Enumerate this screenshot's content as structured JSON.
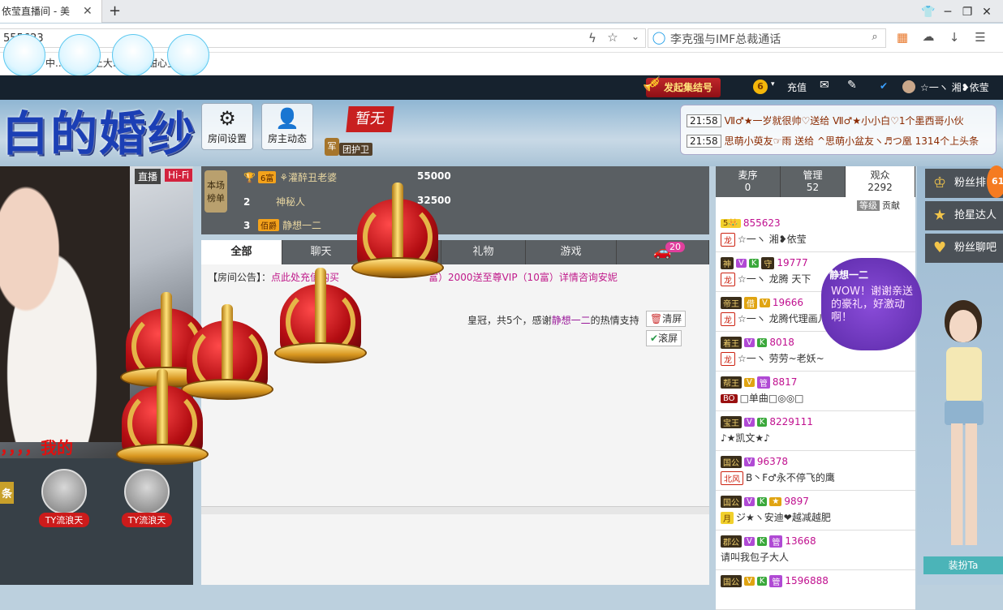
{
  "browser": {
    "tab_title": "依莹直播间 - 美",
    "url": "555623",
    "search_placeholder": "李克强与IMF总裁通话",
    "bookmarks": "中.. 连接.. 上大.. 东视. 甜心宝"
  },
  "sitebar": {
    "gather_label": "发起集结号",
    "coin": "6",
    "recharge": "充值",
    "username": "☆一ヽ 湘❥依莹"
  },
  "header": {
    "big_title": "白的婚纱",
    "room_settings": "房间设置",
    "host_news": "房主动态",
    "status_badge": "暂无",
    "guard_badge": "军",
    "guard_label": "团护卫"
  },
  "messages": [
    {
      "time": "21:58",
      "text": "Ⅶ♂★一岁就很帅♡送给 Ⅶ♂★小小白♡1个墨西哥小伙"
    },
    {
      "time": "21:58",
      "text": "思萌小萸友☞雨 送给 ^思萌小盆友ヽ♬つ凰 1314个上头条"
    }
  ],
  "video": {
    "live": "直播",
    "hifi": "Hi-Fi",
    "caption": "，，，，我的",
    "side_tag": "条",
    "users": [
      "TY流浪天",
      "TY流浪天"
    ]
  },
  "rank": {
    "label": "本场榜单",
    "rows": [
      {
        "n": "",
        "badge": "6富",
        "name": "⚘灌醉丑老婆",
        "score": "55000"
      },
      {
        "n": "2",
        "badge": "",
        "name": "神秘人",
        "score": "32500"
      },
      {
        "n": "3",
        "badge": "佰爵",
        "name": "静想一二",
        "score": ""
      }
    ]
  },
  "chat": {
    "tabs": [
      "全部",
      "聊天",
      "",
      "礼物",
      "游戏",
      ""
    ],
    "car_count": "20",
    "notice_prefix": "【房间公告】：",
    "notice_link": "点此处充值购买",
    "notice_rest": "富）2000送至尊VIP（10富）详情咨询安妮",
    "msg_text": "皇冠，共5个，感谢",
    "msg_user": "静想一二",
    "msg_tail": "的热情支持",
    "clear_btn": "清屏",
    "scroll_btn": "滚屏"
  },
  "userlist": {
    "tabs": [
      {
        "label": "麦序",
        "count": "0"
      },
      {
        "label": "管理",
        "count": "52"
      },
      {
        "label": "观众",
        "count": "2292"
      }
    ],
    "sort_level": "等级",
    "sort_contrib": "贡献",
    "rows": [
      {
        "badges": [
          "5👑"
        ],
        "id": "855623",
        "tag": "龙",
        "name": "☆一ヽ 湘❥依莹"
      },
      {
        "badges": [
          "神",
          "V",
          "K",
          "守"
        ],
        "id": "19777",
        "tag": "龙",
        "name": "☆一ヽ 龙腾 天下"
      },
      {
        "badges": [
          "帝王",
          "借",
          "V"
        ],
        "id": "19666",
        "tag": "龙",
        "name": "☆一ヽ 龙腾代理画儿"
      },
      {
        "badges": [
          "着王",
          "V",
          "K"
        ],
        "id": "8018",
        "tag": "龙",
        "name": "☆一ヽ 劳劳~老妖~"
      },
      {
        "badges": [
          "帮王",
          "V",
          "管"
        ],
        "id": "8817",
        "tag": "BO",
        "name": "□单曲□◎◎□"
      },
      {
        "badges": [
          "宝王",
          "V",
          "K"
        ],
        "id": "8229111",
        "tag": "",
        "name": "♪★凯文★♪"
      },
      {
        "badges": [
          "国公",
          "V"
        ],
        "id": "96378",
        "tag": "北风",
        "name": "B丶F♂永不停飞的鹰"
      },
      {
        "badges": [
          "国公",
          "V",
          "K",
          "★"
        ],
        "id": "9897",
        "tag": "月",
        "name": "ジ★ヽ安迪❤越减越肥"
      },
      {
        "badges": [
          "郡公",
          "V",
          "K",
          "管"
        ],
        "id": "13668",
        "tag": "",
        "name": "请叫我包子大人"
      },
      {
        "badges": [
          "国公",
          "V",
          "K",
          "管"
        ],
        "id": "1596888",
        "tag": "",
        "name": ""
      }
    ]
  },
  "rightside": {
    "fans_rank": "粉丝排",
    "badge_count": "61",
    "grab_star": "抢星达人",
    "fans_chat": "粉丝聊吧",
    "speech_name": "静想一二",
    "speech_text": "WOW！谢谢亲送的豪礼，好激动啊！",
    "dress_btn": "装扮Ta"
  }
}
